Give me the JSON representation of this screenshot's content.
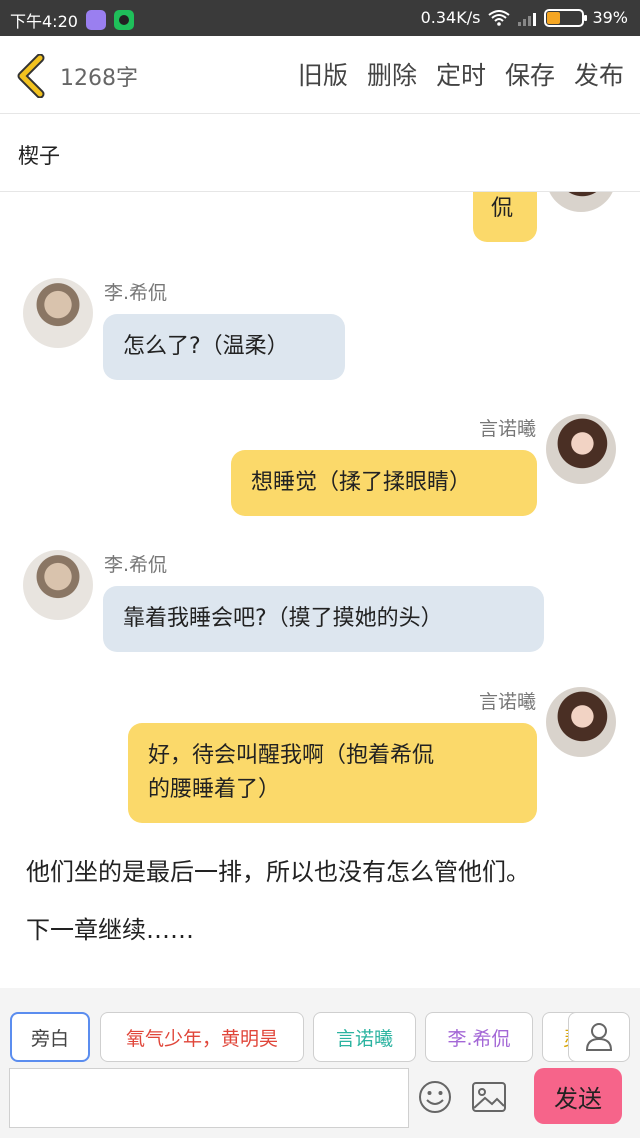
{
  "status_bar": {
    "time": "下午4:20",
    "net_speed": "0.34K/s",
    "battery": "39%",
    "battery_level": 0.39,
    "battery_color": "#f5a623"
  },
  "top_bar": {
    "back_icon": "chevron-left-icon",
    "word_count": "1268字",
    "actions": [
      "旧版",
      "删除",
      "定时",
      "保存",
      "发布"
    ]
  },
  "chapter_title": "楔子",
  "messages": [
    {
      "side": "right",
      "speaker": "",
      "text": "侃"
    },
    {
      "side": "left",
      "speaker": "李.希侃",
      "text": "怎么了?（温柔）"
    },
    {
      "side": "right",
      "speaker": "言诺曦",
      "text": "想睡觉（揉了揉眼睛）"
    },
    {
      "side": "left",
      "speaker": "李.希侃",
      "text": "靠着我睡会吧?（摸了摸她的头）"
    },
    {
      "side": "right",
      "speaker": "言诺曦",
      "lines": [
        "好，待会叫醒我啊（抱着希侃",
        "的腰睡着了）"
      ]
    }
  ],
  "narration": [
    "他们坐的是最后一排，所以也没有怎么管他们。",
    "下一章继续……"
  ],
  "characters": [
    {
      "name": "旁白",
      "color": "#444444"
    },
    {
      "name": "氧气少年，黄明昊",
      "color": "#e0463a"
    },
    {
      "name": "言诺曦",
      "color": "#2bb3a0"
    },
    {
      "name": "李.希侃",
      "color": "#a367d6"
    },
    {
      "name": "灵",
      "color": "#d9a400"
    }
  ],
  "input": {
    "value": "",
    "placeholder": ""
  },
  "send_label": "发送",
  "colors": {
    "bubble_left": "#dde6ef",
    "bubble_right": "#fbd96a",
    "send": "#f6648a",
    "back_icon": "#f2c21f"
  }
}
